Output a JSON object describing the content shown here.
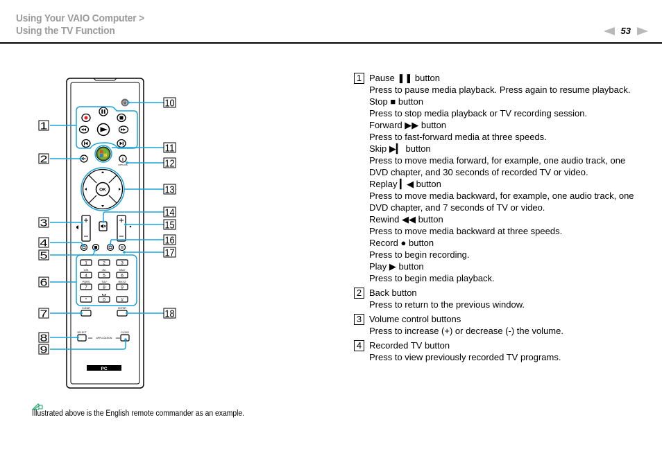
{
  "header": {
    "breadcrumb_line1": "Using Your VAIO Computer >",
    "breadcrumb_line2": "Using the TV Function",
    "page_number": "53",
    "prev_icon": "triangle-left-icon",
    "next_icon": "triangle-right-icon"
  },
  "figure": {
    "callouts_left": [
      "1",
      "2",
      "3",
      "4",
      "5",
      "6",
      "7",
      "8",
      "9"
    ],
    "callouts_right": [
      "10",
      "11",
      "12",
      "13",
      "14",
      "15",
      "16",
      "17",
      "18"
    ],
    "remote_labels": {
      "ok": "OK",
      "options": "OPTIONS",
      "keypad": [
        "1",
        "2",
        "3",
        "4",
        "5",
        "6",
        "7",
        "8",
        "9",
        "*",
        "0",
        "#"
      ],
      "keypad_letters": [
        "GHI",
        "JKL",
        "MNO",
        "PQRS",
        "TUV",
        "WXYZ"
      ],
      "clear": "CLEAR",
      "enter": "ENTER",
      "select": "SELECT",
      "application": "APPLICATION",
      "close": "CLOSE",
      "pc": "PC"
    },
    "accent_color": "#1aa3db",
    "record_color": "#e8202a"
  },
  "note": {
    "icon": "pencil-note-icon",
    "text": "Illustrated above is the English remote commander as an example."
  },
  "descriptions": [
    {
      "number": "1",
      "lines": [
        "Pause ❚❚ button",
        "Press to pause media playback. Press again to resume playback.",
        "Stop ■ button",
        "Press to stop media playback or TV recording session.",
        "Forward ▶▶ button",
        "Press to fast-forward media at three speeds.",
        "Skip ▶▎ button",
        "Press to move media forward, for example, one audio track, one DVD chapter, and 30 seconds of recorded TV or video.",
        "Replay ▎◀ button",
        "Press to move media backward, for example, one audio track, one DVD chapter, and 7 seconds of TV or video.",
        "Rewind ◀◀ button",
        "Press to move media backward at three speeds.",
        "Record ● button",
        "Press to begin recording.",
        "Play ▶ button",
        "Press to begin media playback."
      ]
    },
    {
      "number": "2",
      "lines": [
        "Back button",
        "Press to return to the previous window."
      ]
    },
    {
      "number": "3",
      "lines": [
        "Volume control buttons",
        "Press to increase (+) or decrease (-) the volume."
      ]
    },
    {
      "number": "4",
      "lines": [
        "Recorded TV button",
        "Press to view previously recorded TV programs."
      ]
    }
  ]
}
